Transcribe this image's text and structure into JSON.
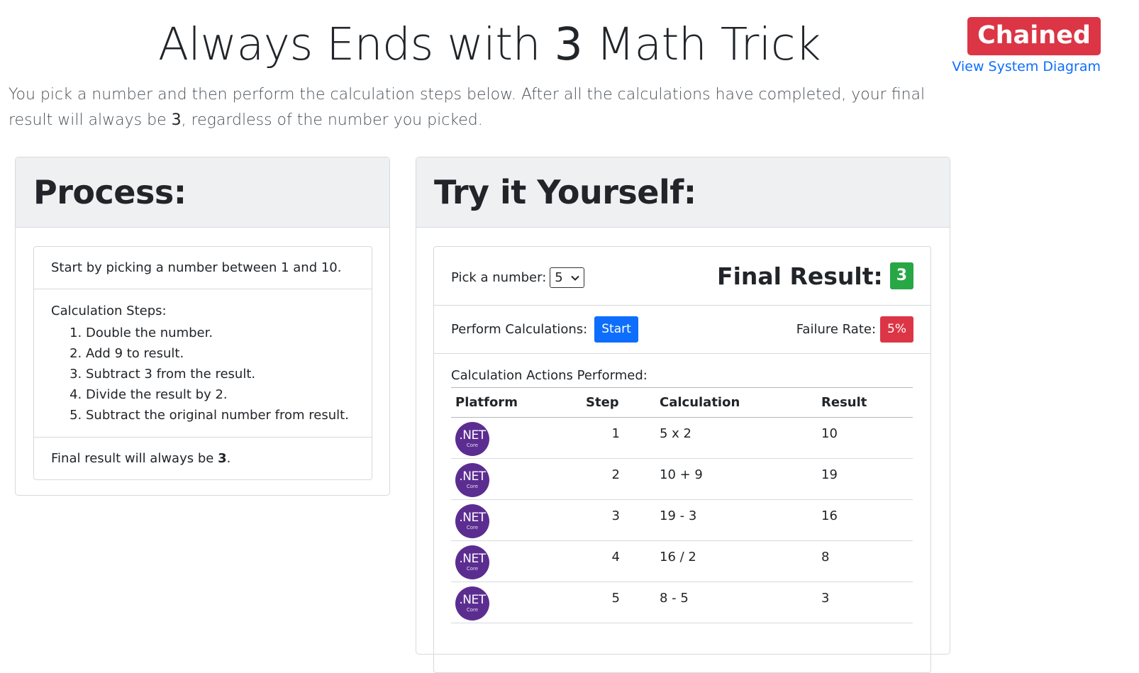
{
  "header": {
    "title_pre": "Always Ends with ",
    "title_num": "3",
    "title_post": " Math Trick",
    "badge": "Chained",
    "diagram_link": "View System Diagram"
  },
  "intro": {
    "text_pre": "You pick a number and then perform the calculation steps below. After all the calculations have completed, your final result will always be ",
    "num": "3",
    "text_post": ", regardless of the number you picked."
  },
  "process": {
    "title": "Process:",
    "start": "Start by picking a number between 1 and 10.",
    "steps_label": "Calculation Steps:",
    "steps": [
      "Double the number.",
      "Add 9 to result.",
      "Subtract 3 from the result.",
      "Divide the result by 2.",
      "Subtract the original number from result."
    ],
    "final_pre": "Final result will always be ",
    "final_num": "3",
    "final_post": "."
  },
  "try": {
    "title": "Try it Yourself:",
    "pick_label": "Pick a number:",
    "pick_value": "5",
    "final_label": "Final Result:",
    "final_value": "3",
    "perform_label": "Perform Calculations:",
    "start_button": "Start",
    "failure_label": "Failure Rate:",
    "failure_value": "5%",
    "actions_label": "Calculation Actions Performed:",
    "columns": [
      "Platform",
      "Step",
      "Calculation",
      "Result"
    ],
    "rows": [
      {
        "platform_top": ".NET",
        "platform_sub": "Core",
        "step": "1",
        "calc": "5 x 2",
        "result": "10"
      },
      {
        "platform_top": ".NET",
        "platform_sub": "Core",
        "step": "2",
        "calc": "10 + 9",
        "result": "19"
      },
      {
        "platform_top": ".NET",
        "platform_sub": "Core",
        "step": "3",
        "calc": "19 - 3",
        "result": "16"
      },
      {
        "platform_top": ".NET",
        "platform_sub": "Core",
        "step": "4",
        "calc": "16 / 2",
        "result": "8"
      },
      {
        "platform_top": ".NET",
        "platform_sub": "Core",
        "step": "5",
        "calc": "8 - 5",
        "result": "3"
      }
    ]
  }
}
